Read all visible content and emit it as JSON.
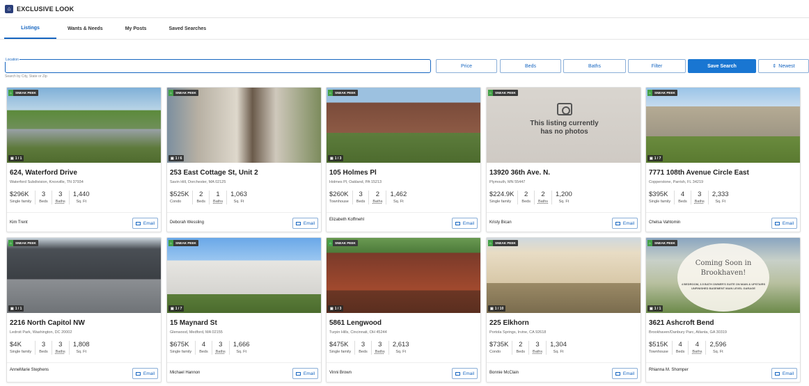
{
  "app": {
    "brand": "EXCLUSIVE LOOK"
  },
  "tabs": [
    {
      "label": "Listings",
      "active": true
    },
    {
      "label": "Wants & Needs"
    },
    {
      "label": "My Posts"
    },
    {
      "label": "Saved Searches"
    }
  ],
  "search": {
    "label": "Location",
    "value": "",
    "help": "Search by City, State or Zip"
  },
  "filters": {
    "price": "Price",
    "beds": "Beds",
    "baths": "Baths",
    "filter": "Filter",
    "save": "Save Search",
    "sort": "Newest"
  },
  "badge": "SNEAK PEEK",
  "email_label": "Email",
  "nophoto_text": "This listing currently has no photos",
  "coming_soon": {
    "title": "Coming Soon in Brookhaven!",
    "detail": "4 BEDROOM, 3.5 BATH OWNER'S SUITE ON MAIN & UPSTAIRS UNFINISHED BASEMENT MAIN LEVEL GARAGE"
  },
  "listings": [
    {
      "counter": "1 / 1",
      "address": "624, Waterford Drive",
      "sub": "Waterford Subdivision, Knoxville, TN 37934",
      "price": "$296K",
      "type": "Single family",
      "beds": "3",
      "baths": "3",
      "sqft": "1,440",
      "agent": "Kim Trent"
    },
    {
      "counter": "1 / 6",
      "address": "253 East Cottage St, Unit 2",
      "sub": "Savin Hill, Dorchester, MA 02125",
      "price": "$525K",
      "type": "Condo",
      "beds": "2",
      "baths": "1",
      "sqft": "1,063",
      "agent": "Deborah Wessling"
    },
    {
      "counter": "1 / 3",
      "address": "105 Holmes Pl",
      "sub": "Holmes Pl, Oakland, PA 15213",
      "price": "$260K",
      "type": "Townhouse",
      "beds": "3",
      "baths": "2",
      "sqft": "1,462",
      "agent": "Elizabeth Koffmehl"
    },
    {
      "counter": "",
      "address": "13920 36th Ave. N.",
      "sub": "Plymouth, MN 55447",
      "price": "$224.9K",
      "type": "Single family",
      "beds": "2",
      "baths": "2",
      "sqft": "1,200",
      "agent": "Kristy Bican"
    },
    {
      "counter": "1 / 7",
      "address": "7771 108th Avenue Circle East",
      "sub": "Copperstone, Parrish, FL 34219",
      "price": "$395K",
      "type": "Single family",
      "beds": "4",
      "baths": "3",
      "sqft": "2,333",
      "agent": "Chelsa Vahtomin"
    },
    {
      "counter": "1 / 1",
      "address": "2216 North Capitol NW",
      "sub": "Ledroit Park, Washington, DC 20002",
      "price": "$4K",
      "type": "Single family",
      "beds": "3",
      "baths": "3",
      "sqft": "1,808",
      "agent": "AnneMarie Stephens"
    },
    {
      "counter": "1 / 7",
      "address": "15 Maynard St",
      "sub": "Glenwood, Medford, MA 02155",
      "price": "$675K",
      "type": "Single family",
      "beds": "4",
      "baths": "3",
      "sqft": "1,666",
      "agent": "Michael Hannon"
    },
    {
      "counter": "1 / 3",
      "address": "5861 Lengwood",
      "sub": "Turpin Hills, Cincinnati, OH 45244",
      "price": "$475K",
      "type": "Single family",
      "beds": "3",
      "baths": "3",
      "sqft": "2,613",
      "agent": "Vinni Brown"
    },
    {
      "counter": "1 / 10",
      "address": "225 Elkhorn",
      "sub": "Portola Springs, Irvine, CA 92618",
      "price": "$735K",
      "type": "Condo",
      "beds": "2",
      "baths": "3",
      "sqft": "1,304",
      "agent": "Bonnie McClain"
    },
    {
      "counter": "1 / 1",
      "address": "3621 Ashcroft Bend",
      "sub": "Brookhaven/Danbury Parc, Atlanta, GA 30319",
      "price": "$515K",
      "type": "Townhouse",
      "beds": "4",
      "baths": "4",
      "sqft": "2,596",
      "agent": "Rhianna M. Shomper"
    }
  ],
  "labels": {
    "beds": "Beds",
    "baths": "Baths",
    "sqft": "Sq. Ft"
  }
}
